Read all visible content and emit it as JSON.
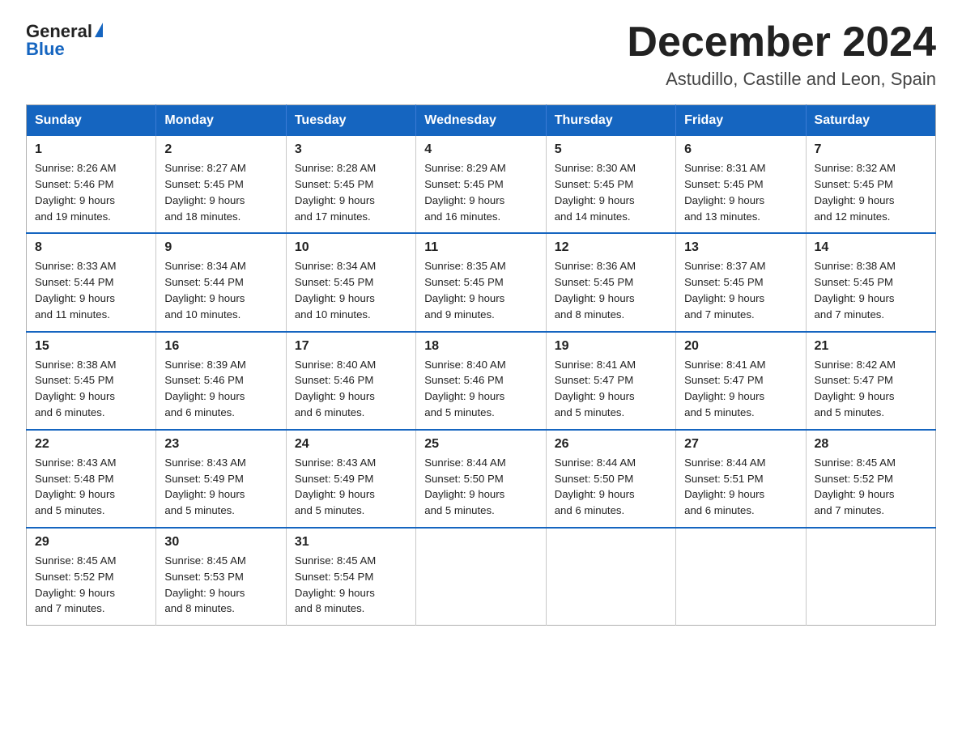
{
  "header": {
    "logo_general": "General",
    "logo_blue": "Blue",
    "month_title": "December 2024",
    "location": "Astudillo, Castille and Leon, Spain"
  },
  "weekdays": [
    "Sunday",
    "Monday",
    "Tuesday",
    "Wednesday",
    "Thursday",
    "Friday",
    "Saturday"
  ],
  "weeks": [
    [
      {
        "day": "1",
        "sunrise": "8:26 AM",
        "sunset": "5:46 PM",
        "daylight": "9 hours and 19 minutes."
      },
      {
        "day": "2",
        "sunrise": "8:27 AM",
        "sunset": "5:45 PM",
        "daylight": "9 hours and 18 minutes."
      },
      {
        "day": "3",
        "sunrise": "8:28 AM",
        "sunset": "5:45 PM",
        "daylight": "9 hours and 17 minutes."
      },
      {
        "day": "4",
        "sunrise": "8:29 AM",
        "sunset": "5:45 PM",
        "daylight": "9 hours and 16 minutes."
      },
      {
        "day": "5",
        "sunrise": "8:30 AM",
        "sunset": "5:45 PM",
        "daylight": "9 hours and 14 minutes."
      },
      {
        "day": "6",
        "sunrise": "8:31 AM",
        "sunset": "5:45 PM",
        "daylight": "9 hours and 13 minutes."
      },
      {
        "day": "7",
        "sunrise": "8:32 AM",
        "sunset": "5:45 PM",
        "daylight": "9 hours and 12 minutes."
      }
    ],
    [
      {
        "day": "8",
        "sunrise": "8:33 AM",
        "sunset": "5:44 PM",
        "daylight": "9 hours and 11 minutes."
      },
      {
        "day": "9",
        "sunrise": "8:34 AM",
        "sunset": "5:44 PM",
        "daylight": "9 hours and 10 minutes."
      },
      {
        "day": "10",
        "sunrise": "8:34 AM",
        "sunset": "5:45 PM",
        "daylight": "9 hours and 10 minutes."
      },
      {
        "day": "11",
        "sunrise": "8:35 AM",
        "sunset": "5:45 PM",
        "daylight": "9 hours and 9 minutes."
      },
      {
        "day": "12",
        "sunrise": "8:36 AM",
        "sunset": "5:45 PM",
        "daylight": "9 hours and 8 minutes."
      },
      {
        "day": "13",
        "sunrise": "8:37 AM",
        "sunset": "5:45 PM",
        "daylight": "9 hours and 7 minutes."
      },
      {
        "day": "14",
        "sunrise": "8:38 AM",
        "sunset": "5:45 PM",
        "daylight": "9 hours and 7 minutes."
      }
    ],
    [
      {
        "day": "15",
        "sunrise": "8:38 AM",
        "sunset": "5:45 PM",
        "daylight": "9 hours and 6 minutes."
      },
      {
        "day": "16",
        "sunrise": "8:39 AM",
        "sunset": "5:46 PM",
        "daylight": "9 hours and 6 minutes."
      },
      {
        "day": "17",
        "sunrise": "8:40 AM",
        "sunset": "5:46 PM",
        "daylight": "9 hours and 6 minutes."
      },
      {
        "day": "18",
        "sunrise": "8:40 AM",
        "sunset": "5:46 PM",
        "daylight": "9 hours and 5 minutes."
      },
      {
        "day": "19",
        "sunrise": "8:41 AM",
        "sunset": "5:47 PM",
        "daylight": "9 hours and 5 minutes."
      },
      {
        "day": "20",
        "sunrise": "8:41 AM",
        "sunset": "5:47 PM",
        "daylight": "9 hours and 5 minutes."
      },
      {
        "day": "21",
        "sunrise": "8:42 AM",
        "sunset": "5:47 PM",
        "daylight": "9 hours and 5 minutes."
      }
    ],
    [
      {
        "day": "22",
        "sunrise": "8:43 AM",
        "sunset": "5:48 PM",
        "daylight": "9 hours and 5 minutes."
      },
      {
        "day": "23",
        "sunrise": "8:43 AM",
        "sunset": "5:49 PM",
        "daylight": "9 hours and 5 minutes."
      },
      {
        "day": "24",
        "sunrise": "8:43 AM",
        "sunset": "5:49 PM",
        "daylight": "9 hours and 5 minutes."
      },
      {
        "day": "25",
        "sunrise": "8:44 AM",
        "sunset": "5:50 PM",
        "daylight": "9 hours and 5 minutes."
      },
      {
        "day": "26",
        "sunrise": "8:44 AM",
        "sunset": "5:50 PM",
        "daylight": "9 hours and 6 minutes."
      },
      {
        "day": "27",
        "sunrise": "8:44 AM",
        "sunset": "5:51 PM",
        "daylight": "9 hours and 6 minutes."
      },
      {
        "day": "28",
        "sunrise": "8:45 AM",
        "sunset": "5:52 PM",
        "daylight": "9 hours and 7 minutes."
      }
    ],
    [
      {
        "day": "29",
        "sunrise": "8:45 AM",
        "sunset": "5:52 PM",
        "daylight": "9 hours and 7 minutes."
      },
      {
        "day": "30",
        "sunrise": "8:45 AM",
        "sunset": "5:53 PM",
        "daylight": "9 hours and 8 minutes."
      },
      {
        "day": "31",
        "sunrise": "8:45 AM",
        "sunset": "5:54 PM",
        "daylight": "9 hours and 8 minutes."
      },
      null,
      null,
      null,
      null
    ]
  ],
  "labels": {
    "sunrise": "Sunrise:",
    "sunset": "Sunset:",
    "daylight": "Daylight:"
  }
}
